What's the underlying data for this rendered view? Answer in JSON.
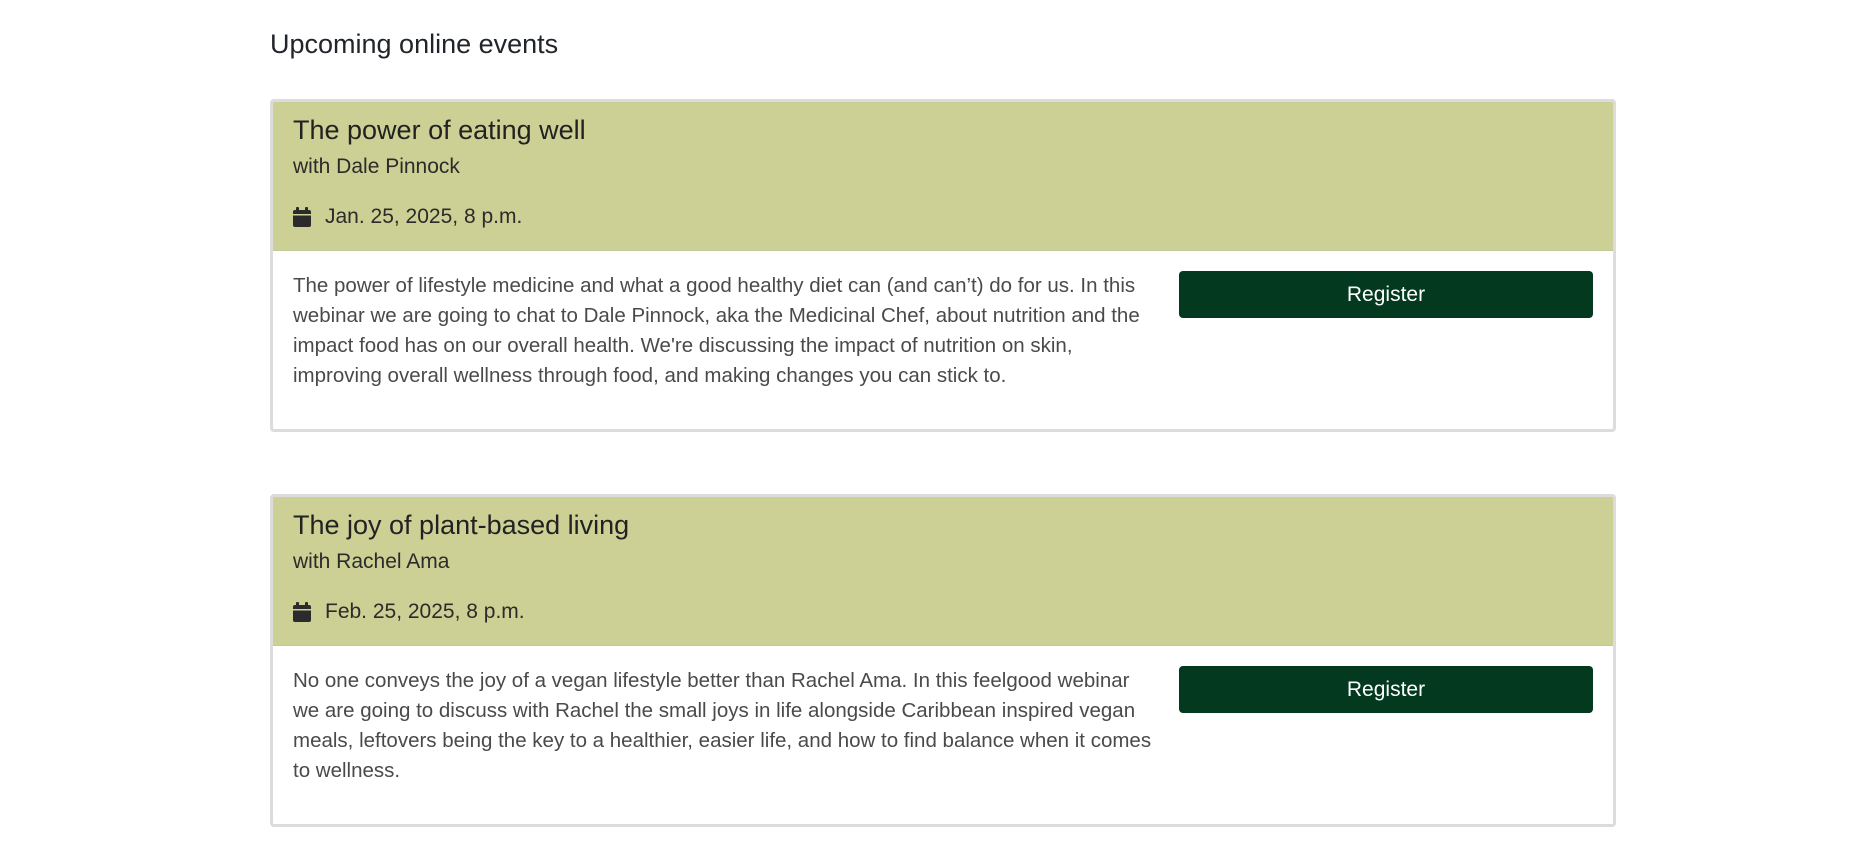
{
  "section": {
    "title": "Upcoming online events"
  },
  "events": [
    {
      "title": "The power of eating well",
      "host": "with Dale Pinnock",
      "date": "Jan. 25, 2025, 8 p.m.",
      "description": "The power of lifestyle medicine and what a good healthy diet can (and can’t) do for us. In this webinar we are going to chat to Dale Pinnock, aka the Medicinal Chef, about nutrition and the impact food has on our overall health. We're discussing the impact of nutrition on skin, improving overall wellness through food, and making changes you can stick to.",
      "register_label": "Register"
    },
    {
      "title": "The joy of plant-based living",
      "host": "with Rachel Ama",
      "date": "Feb. 25, 2025, 8 p.m.",
      "description": "No one conveys the joy of a vegan lifestyle better than Rachel Ama. In this feelgood webinar we are going to discuss with Rachel the small joys in life alongside Caribbean inspired vegan meals, leftovers being the key to a healthier, easier life, and how to find balance when it comes to wellness.",
      "register_label": "Register"
    }
  ],
  "icons": {
    "date": "calendar-icon"
  },
  "colors": {
    "header_bg": "#ccd094",
    "button_bg": "#02391f",
    "button_text": "#ffffff"
  }
}
